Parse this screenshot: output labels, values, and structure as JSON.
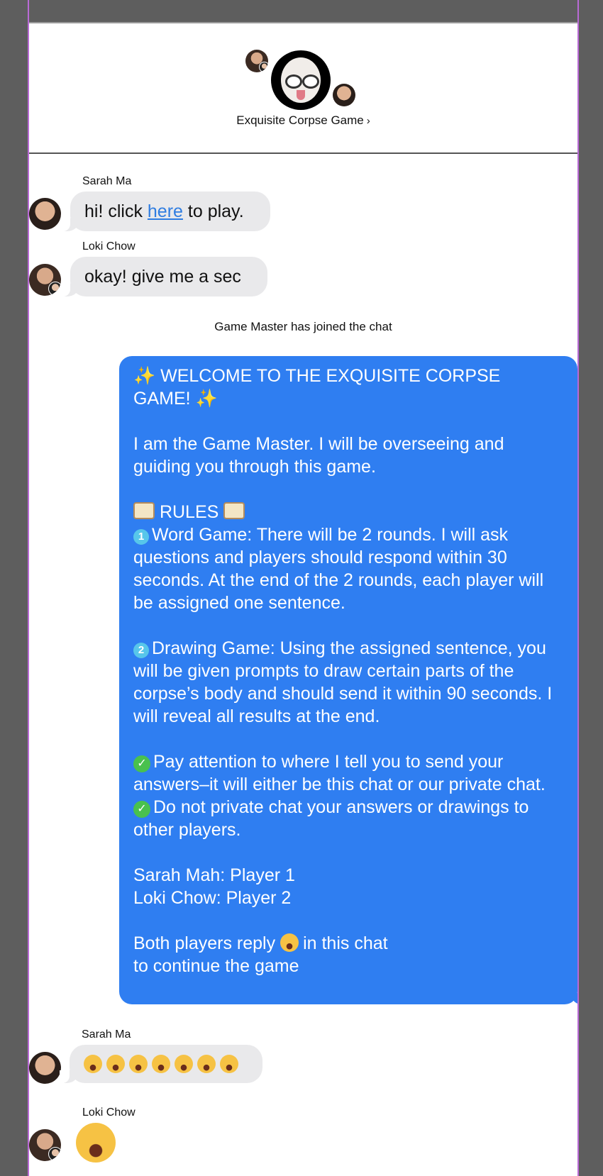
{
  "header": {
    "group_name": "Exquisite Corpse Game",
    "chevron": "›"
  },
  "messages": {
    "m1": {
      "sender": "Sarah Ma",
      "text_before": "hi! click ",
      "link": "here",
      "text_after": " to play."
    },
    "m2": {
      "sender": "Loki Chow",
      "text": "okay! give me a sec"
    },
    "system": "Game Master has joined the chat",
    "gm": {
      "title_line1": "WELCOME TO THE EXQUISITE CORPSE",
      "title_line2": "GAME!",
      "intro": "I am the Game Master. I will be overseeing and guiding you through this game.",
      "rules_heading": "RULES",
      "rule1": "Word Game: There will be 2 rounds. I will ask questions and players should respond within 30 seconds. At the end of the 2 rounds, each player will be assigned one sentence.",
      "rule2": "Drawing Game: Using the assigned sentence, you will be given prompts to draw certain parts of the corpse’s body and should send it within 90 seconds. I will reveal all results at the end.",
      "note1": "Pay attention to where I tell you to send your answers–it will either be this chat or our private chat.",
      "note2": "Do not private chat your answers or drawings to other players.",
      "player1": "Sarah Mah: Player 1",
      "player2": "Loki Chow: Player 2",
      "closing_before": "Both players reply",
      "closing_after": "in this chat",
      "closing_line2": "to continue the game",
      "num1": "1",
      "num2": "2",
      "check": "✓",
      "sparkle": "✨"
    },
    "m3": {
      "sender": "Sarah Ma",
      "emoji_count": 7
    },
    "m4": {
      "sender": "Loki Chow"
    }
  }
}
